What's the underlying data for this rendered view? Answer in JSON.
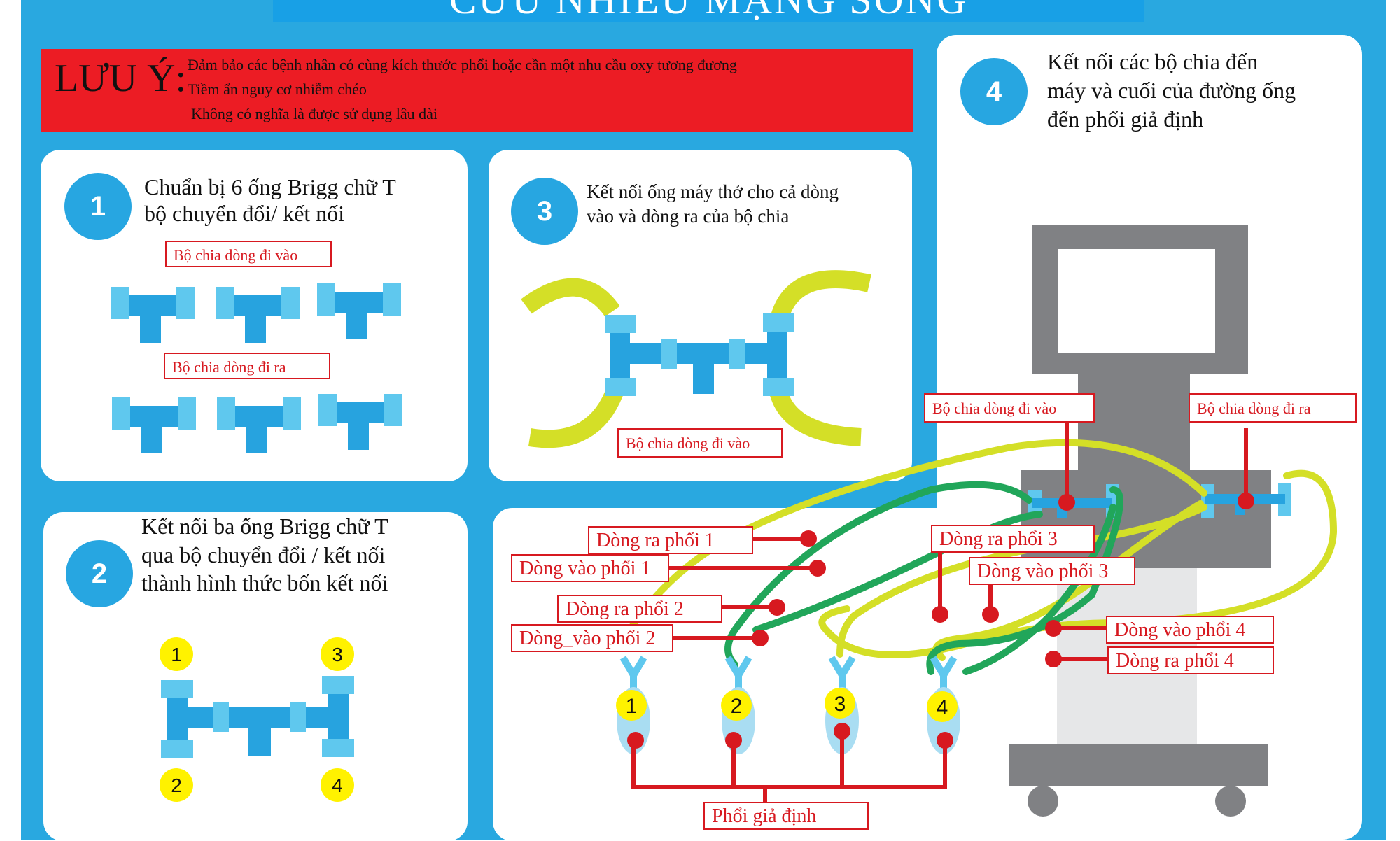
{
  "title": "CỨU NHIỀU MẠNG SỐNG",
  "notice": {
    "heading": "LƯU Ý:",
    "lines": [
      "Đảm bảo các bệnh nhân có cùng kích thước phổi hoặc cần một nhu cầu oxy tương đương",
      "Tiềm ẩn nguy cơ nhiễm chéo",
      "Không có nghĩa là được sử dụng lâu dài"
    ]
  },
  "steps": [
    {
      "number": "1",
      "title_lines": [
        "Chuẩn bị 6 ống Brigg chữ T",
        "bộ chuyển đổi/ kết nối"
      ]
    },
    {
      "number": "2",
      "title_lines": [
        "Kết nối ba ống Brigg chữ T",
        "qua bộ chuyển đổi / kết nối",
        "thành hình thức bốn kết nối"
      ]
    },
    {
      "number": "3",
      "title_lines": [
        "Kết nối ống máy thở cho cả dòng",
        "vào và dòng ra của bộ chia"
      ]
    },
    {
      "number": "4",
      "title_lines": [
        "Kết nối các bộ chia đến",
        "máy và cuối của đường ống",
        "đến phổi giả định"
      ]
    }
  ],
  "step1_labels": {
    "inflow": "Bộ chia dòng đi vào",
    "outflow": "Bộ chia dòng đi ra"
  },
  "step2_ports": [
    "1",
    "2",
    "3",
    "4"
  ],
  "step3_label": "Bộ chia dòng đi vào",
  "step4_labels": {
    "inflow": "Bộ chia dòng đi vào",
    "outflow": "Bộ chia dòng đi ra"
  },
  "lung_labels": {
    "out1": "Dòng ra phổi 1",
    "in1": "Dòng vào phổi 1",
    "out2": "Dòng ra phổi 2",
    "in2": "Dòng_vào phổi 2",
    "out3": "Dòng ra phổi 3",
    "in3": "Dòng vào phổi 3",
    "in4": "Dòng vào phổi 4",
    "out4": "Dòng ra phổi 4"
  },
  "lung_numbers": [
    "1",
    "2",
    "3",
    "4"
  ],
  "test_lung_label": "Phổi giả định",
  "colors": {
    "background": "#29a8e0",
    "notice_red": "#ec1c24",
    "connector_blue": "#27a3df",
    "connector_light": "#5fc8ee",
    "tube_yellow": "#d4df27",
    "tube_green": "#21a65a",
    "label_red": "#d71920",
    "port_yellow": "#fff200",
    "machine_gray": "#808184"
  }
}
